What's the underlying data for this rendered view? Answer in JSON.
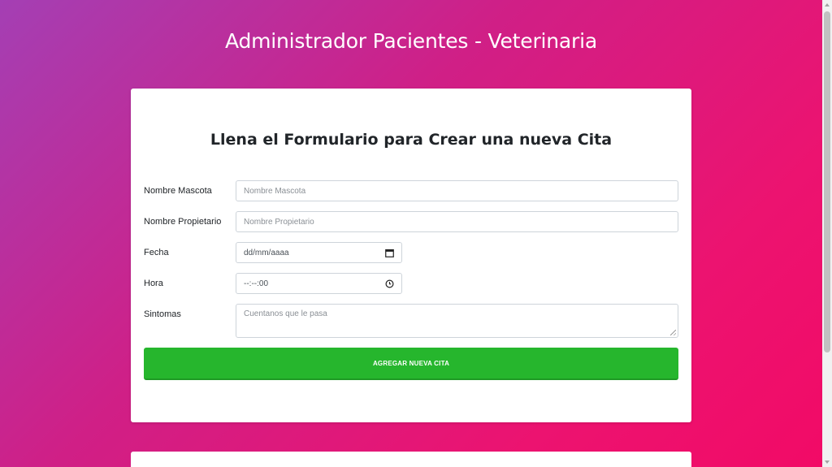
{
  "header": {
    "title": "Administrador Pacientes - Veterinaria"
  },
  "form": {
    "title": "Llena el Formulario para Crear una nueva Cita",
    "fields": {
      "mascota": {
        "label": "Nombre Mascota",
        "placeholder": "Nombre Mascota"
      },
      "propietario": {
        "label": "Nombre Propietario",
        "placeholder": "Nombre Propietario"
      },
      "fecha": {
        "label": "Fecha",
        "value": "dd/mm/aaaa",
        "icon": "calendar-icon"
      },
      "hora": {
        "label": "Hora",
        "value": "--:--:00",
        "icon": "clock-icon"
      },
      "sintomas": {
        "label": "Sintomas",
        "placeholder": "Cuentanos que le pasa"
      }
    },
    "submit_label": "AGREGAR NUEVA CITA"
  },
  "colors": {
    "gradient_start": "#a43fb4",
    "gradient_end": "#f20a66",
    "button": "#26b62d",
    "card": "#ffffff"
  }
}
